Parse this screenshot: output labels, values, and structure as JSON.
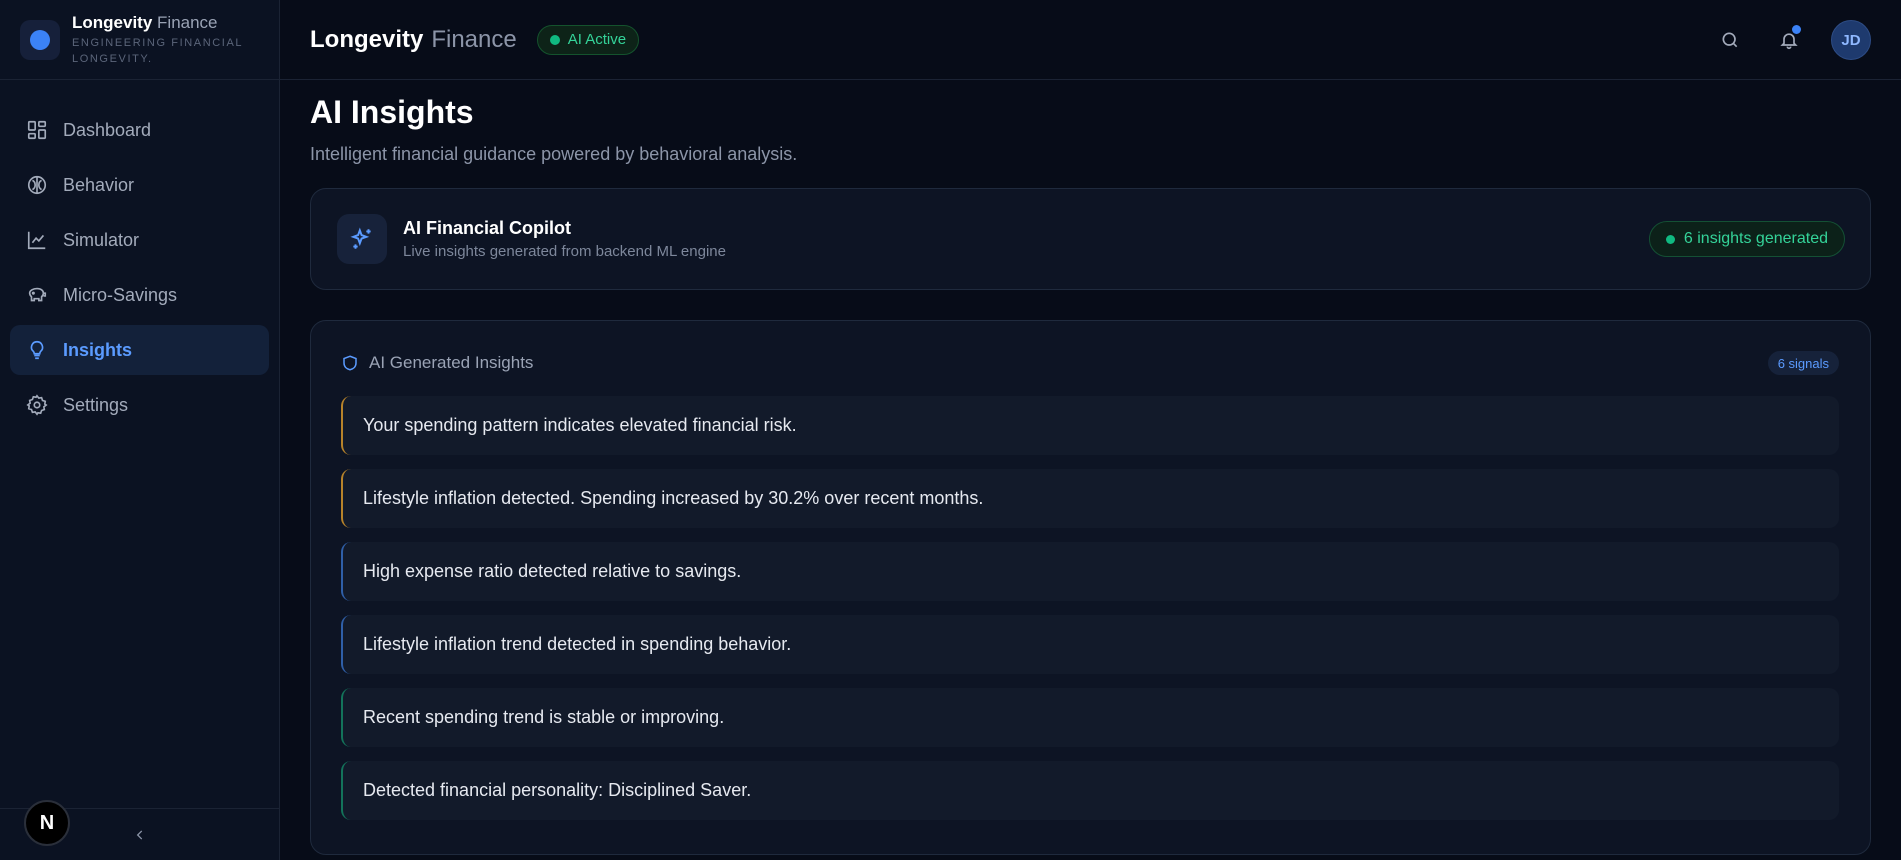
{
  "brand": {
    "name_bold": "Longevity",
    "name_light": "Finance",
    "tagline": "ENGINEERING FINANCIAL LONGEVITY."
  },
  "sidebar": {
    "items": [
      {
        "label": "Dashboard",
        "icon": "dashboard-grid-icon",
        "active": false
      },
      {
        "label": "Behavior",
        "icon": "brain-icon",
        "active": false
      },
      {
        "label": "Simulator",
        "icon": "line-chart-icon",
        "active": false
      },
      {
        "label": "Micro-Savings",
        "icon": "piggy-bank-icon",
        "active": false
      },
      {
        "label": "Insights",
        "icon": "lightbulb-icon",
        "active": true
      },
      {
        "label": "Settings",
        "icon": "gear-icon",
        "active": false
      }
    ],
    "footer_badge": "N",
    "collapse_icon": "chevron-left-icon"
  },
  "header": {
    "title_bold": "Longevity",
    "title_light": "Finance",
    "status_badge": "AI Active",
    "avatar_initials": "JD",
    "icons": [
      "search-icon",
      "bell-icon"
    ]
  },
  "page": {
    "title": "AI Insights",
    "subtitle": "Intelligent financial guidance powered by behavioral analysis."
  },
  "copilot": {
    "title": "AI Financial Copilot",
    "subtitle": "Live insights generated from backend ML engine",
    "badge": "6 insights generated",
    "icon": "sparkles-icon"
  },
  "insights": {
    "heading": "AI Generated Insights",
    "count_badge": "6 signals",
    "items": [
      {
        "text": "Your spending pattern indicates elevated financial risk.",
        "severity": "warn"
      },
      {
        "text": "Lifestyle inflation detected. Spending increased by 30.2% over recent months.",
        "severity": "warn"
      },
      {
        "text": "High expense ratio detected relative to savings.",
        "severity": "info"
      },
      {
        "text": "Lifestyle inflation trend detected in spending behavior.",
        "severity": "info"
      },
      {
        "text": "Recent spending trend is stable or improving.",
        "severity": "good"
      },
      {
        "text": "Detected financial personality: Disciplined Saver.",
        "severity": "good"
      }
    ]
  },
  "colors": {
    "accent": "#3b82f6",
    "success": "#10b981",
    "warning": "#b7832a",
    "background": "#070c18"
  }
}
